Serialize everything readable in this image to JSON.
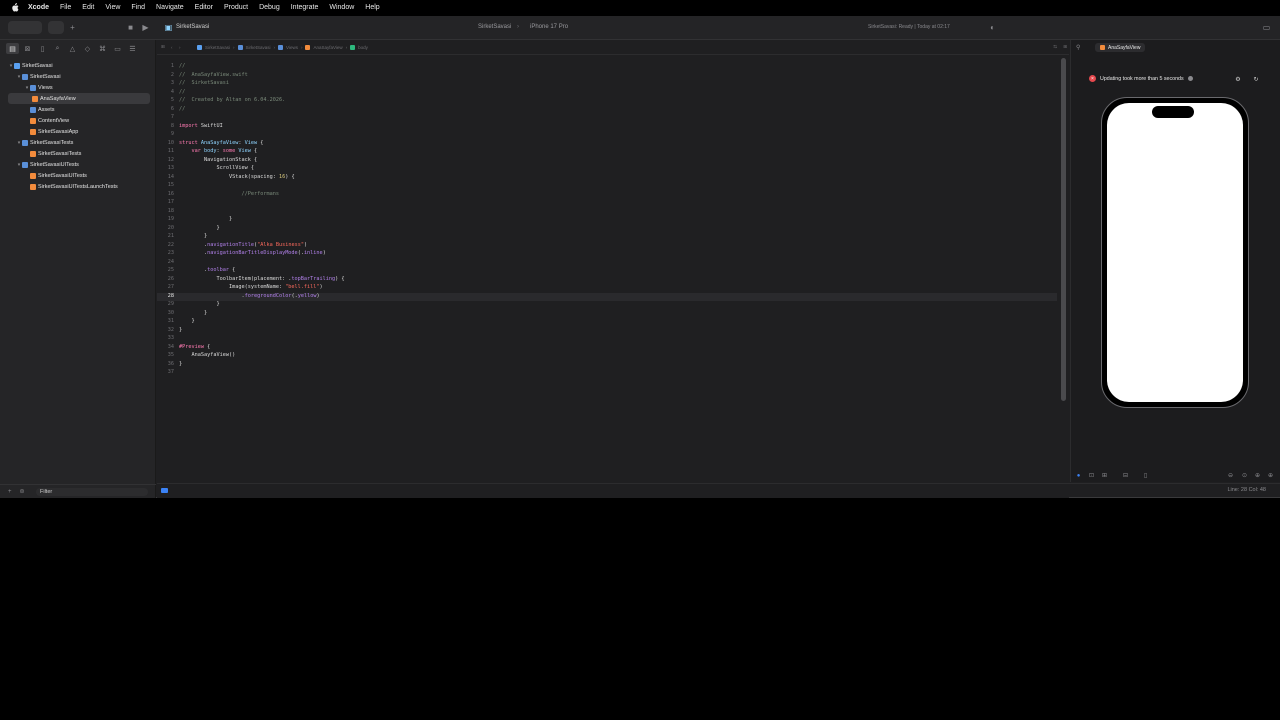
{
  "menubar": {
    "items": [
      "Xcode",
      "File",
      "Edit",
      "View",
      "Find",
      "Navigate",
      "Editor",
      "Product",
      "Debug",
      "Integrate",
      "Window",
      "Help"
    ]
  },
  "toolbar": {
    "project_title": "SirketSavasi",
    "scheme": "SirketSavasi",
    "destination": "iPhone 17 Pro",
    "status": "SirketSavasi: Ready | Today at 02:17"
  },
  "jumpbar": {
    "crumbs": [
      "SirketSavasi",
      "SirketSavasi",
      "Views",
      "AnaSayfaView",
      "body"
    ]
  },
  "navigator": {
    "items": [
      {
        "label": "SirketSavasi",
        "depth": 0,
        "disclosure": "▾",
        "icon_color": "#5aa0f0"
      },
      {
        "label": "SirketSavasi",
        "depth": 1,
        "disclosure": "▾",
        "icon_color": "#5a8fd8"
      },
      {
        "label": "Views",
        "depth": 2,
        "disclosure": "▾",
        "icon_color": "#5a8fd8"
      },
      {
        "label": "AnaSayfaView",
        "depth": 3,
        "disclosure": "",
        "icon_color": "#f28b3c",
        "selected": true
      },
      {
        "label": "Assets",
        "depth": 2,
        "disclosure": "",
        "icon_color": "#5a8fd8"
      },
      {
        "label": "ContentView",
        "depth": 2,
        "disclosure": "",
        "icon_color": "#f28b3c"
      },
      {
        "label": "SirketSavasiApp",
        "depth": 2,
        "disclosure": "",
        "icon_color": "#f28b3c"
      },
      {
        "label": "SirketSavasiTests",
        "depth": 1,
        "disclosure": "▾",
        "icon_color": "#5a8fd8"
      },
      {
        "label": "SirketSavasiTests",
        "depth": 2,
        "disclosure": "",
        "icon_color": "#f28b3c"
      },
      {
        "label": "SirketSavasiUITests",
        "depth": 1,
        "disclosure": "▾",
        "icon_color": "#5a8fd8"
      },
      {
        "label": "SirketSavasiUITests",
        "depth": 2,
        "disclosure": "",
        "icon_color": "#f28b3c"
      },
      {
        "label": "SirketSavasiUITestsLaunchTests",
        "depth": 2,
        "disclosure": "",
        "icon_color": "#f28b3c"
      }
    ],
    "filter_label": "Filter"
  },
  "editor": {
    "current_line": 28,
    "lines": [
      [
        [
          "c-com",
          "//"
        ]
      ],
      [
        [
          "c-com",
          "//  AnaSayfaView.swift"
        ]
      ],
      [
        [
          "c-com",
          "//  SirketSavasi"
        ]
      ],
      [
        [
          "c-com",
          "//"
        ]
      ],
      [
        [
          "c-com",
          "//  Created by Altan on 6.04.2026."
        ]
      ],
      [
        [
          "c-com",
          "//"
        ]
      ],
      [],
      [
        [
          "c-kw",
          "import"
        ],
        [
          "c-plain",
          " SwiftUI"
        ]
      ],
      [],
      [
        [
          "c-kw",
          "struct"
        ],
        [
          "c-plain",
          " "
        ],
        [
          "c-type",
          "AnaSayfaView"
        ],
        [
          "c-plain",
          ": "
        ],
        [
          "c-type",
          "View"
        ],
        [
          "c-plain",
          " {"
        ]
      ],
      [
        [
          "c-plain",
          "    "
        ],
        [
          "c-kw",
          "var"
        ],
        [
          "c-plain",
          " "
        ],
        [
          "c-type",
          "body"
        ],
        [
          "c-plain",
          ": "
        ],
        [
          "c-kw",
          "some"
        ],
        [
          "c-plain",
          " "
        ],
        [
          "c-type",
          "View"
        ],
        [
          "c-plain",
          " {"
        ]
      ],
      [
        [
          "c-plain",
          "        NavigationStack {"
        ]
      ],
      [
        [
          "c-plain",
          "            ScrollView {"
        ]
      ],
      [
        [
          "c-plain",
          "                VStack(spacing: "
        ],
        [
          "c-num",
          "16"
        ],
        [
          "c-plain",
          ") {"
        ]
      ],
      [],
      [
        [
          "c-plain",
          "                    "
        ],
        [
          "c-com",
          "//Performans"
        ]
      ],
      [],
      [],
      [
        [
          "c-plain",
          "                }"
        ]
      ],
      [
        [
          "c-plain",
          "            }"
        ]
      ],
      [
        [
          "c-plain",
          "        }"
        ]
      ],
      [
        [
          "c-plain",
          "        ."
        ],
        [
          "c-fn",
          "navigationTitle"
        ],
        [
          "c-plain",
          "("
        ],
        [
          "c-str",
          "\"Alka Business\""
        ],
        [
          "c-plain",
          ")"
        ]
      ],
      [
        [
          "c-plain",
          "        ."
        ],
        [
          "c-fn",
          "navigationBarTitleDisplayMode"
        ],
        [
          "c-plain",
          "(."
        ],
        [
          "c-fn",
          "inline"
        ],
        [
          "c-plain",
          ")"
        ]
      ],
      [],
      [
        [
          "c-plain",
          "        ."
        ],
        [
          "c-fn",
          "toolbar"
        ],
        [
          "c-plain",
          " {"
        ]
      ],
      [
        [
          "c-plain",
          "            ToolbarItem(placement: ."
        ],
        [
          "c-fn",
          "topBarTrailing"
        ],
        [
          "c-plain",
          ") {"
        ]
      ],
      [
        [
          "c-plain",
          "                Image(systemName: "
        ],
        [
          "c-str",
          "\"bell.fill\""
        ],
        [
          "c-plain",
          ")"
        ]
      ],
      [
        [
          "c-plain",
          "                    ."
        ],
        [
          "c-fn",
          "foregroundColor"
        ],
        [
          "c-plain",
          "(."
        ],
        [
          "c-fn",
          "yellow"
        ],
        [
          "c-plain",
          ")"
        ]
      ],
      [
        [
          "c-plain",
          "            }"
        ]
      ],
      [
        [
          "c-plain",
          "        }"
        ]
      ],
      [
        [
          "c-plain",
          "    }"
        ]
      ],
      [
        [
          "c-plain",
          "}"
        ]
      ],
      [],
      [
        [
          "c-kw",
          "#Preview"
        ],
        [
          "c-plain",
          " {"
        ]
      ],
      [
        [
          "c-plain",
          "    AnaSayfaView()"
        ]
      ],
      [
        [
          "c-plain",
          "}"
        ]
      ],
      []
    ]
  },
  "status_bar": {
    "cursor": "Line: 28  Col: 48"
  },
  "canvas": {
    "tab_label": "AnaSayfaView",
    "warning": "Updating took more than 5 seconds",
    "warning_color": "#e5484d"
  }
}
